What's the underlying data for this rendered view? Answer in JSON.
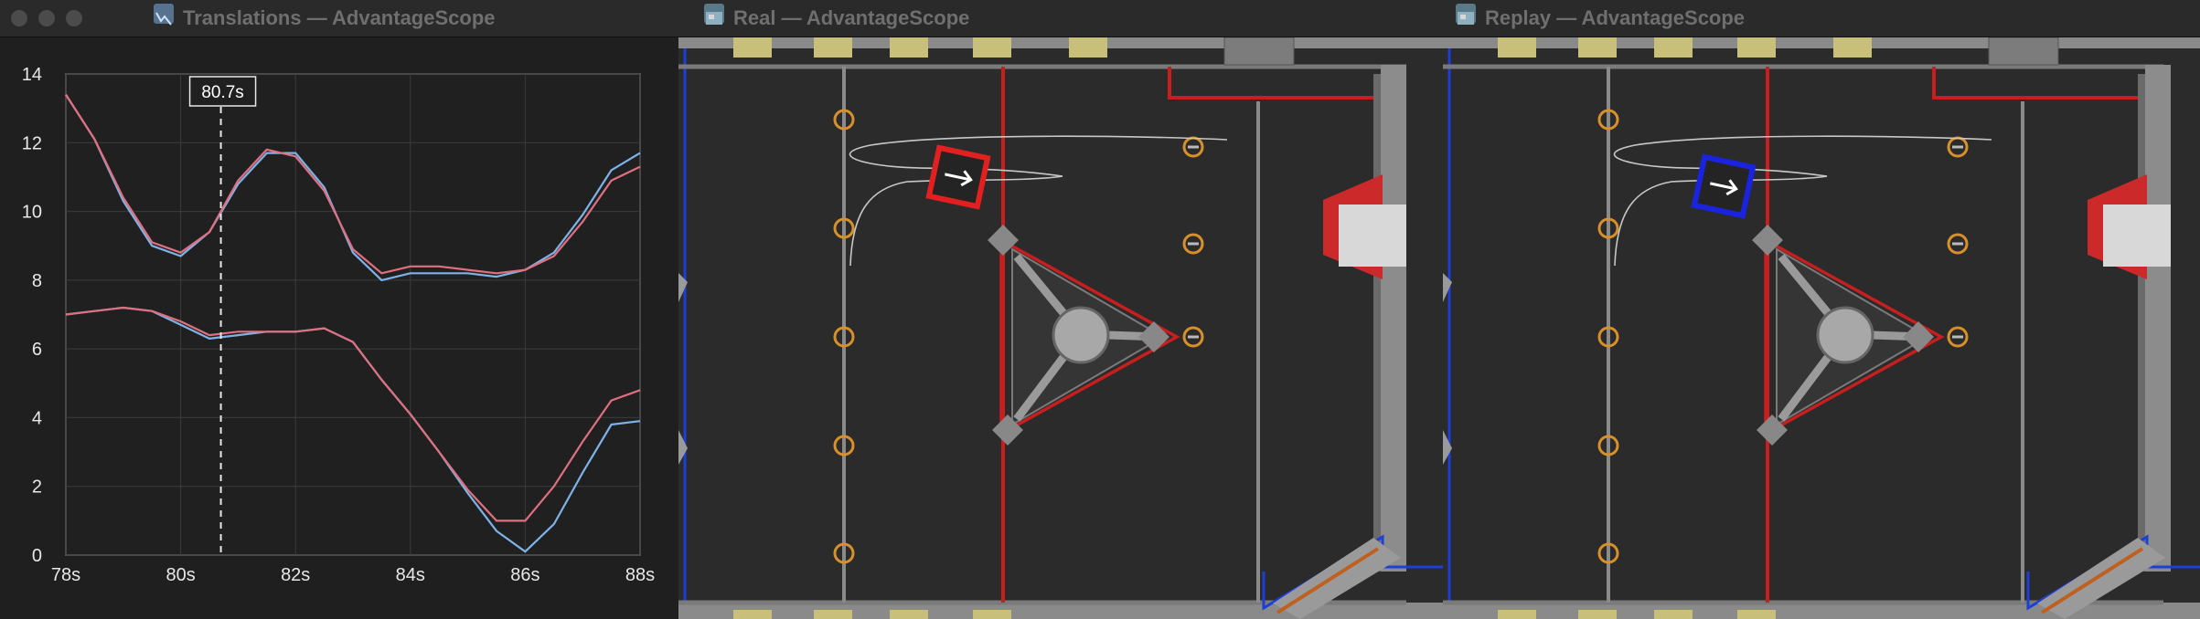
{
  "windows": {
    "translations": {
      "title": "Translations — AdvantageScope",
      "icon": "line-graph-icon"
    },
    "real": {
      "title": "Real — AdvantageScope",
      "icon": "field-map-icon"
    },
    "replay": {
      "title": "Replay — AdvantageScope",
      "icon": "field-map-icon"
    }
  },
  "chart_data": {
    "type": "line",
    "title": "",
    "xlabel": "",
    "ylabel": "",
    "xlim": [
      78,
      88
    ],
    "ylim": [
      0,
      14
    ],
    "x_ticks": [
      "78s",
      "80s",
      "82s",
      "84s",
      "86s",
      "88s"
    ],
    "y_ticks": [
      "0",
      "2",
      "4",
      "6",
      "8",
      "10",
      "12",
      "14"
    ],
    "grid": true,
    "cursor": {
      "x": 80.7,
      "label": "80.7s"
    },
    "x": [
      78,
      78.5,
      79,
      79.5,
      80,
      80.5,
      81,
      81.5,
      82,
      82.5,
      83,
      83.5,
      84,
      84.5,
      85,
      85.5,
      86,
      86.5,
      87,
      87.5,
      88
    ],
    "series": [
      {
        "color": "#7db3e8",
        "values": [
          13.4,
          12.1,
          10.3,
          9.0,
          8.7,
          9.4,
          10.8,
          11.7,
          11.7,
          10.7,
          8.8,
          8.0,
          8.2,
          8.2,
          8.2,
          8.1,
          8.3,
          8.8,
          9.9,
          11.2,
          11.7
        ]
      },
      {
        "color": "#e07080",
        "values": [
          13.4,
          12.1,
          10.4,
          9.1,
          8.8,
          9.4,
          10.9,
          11.8,
          11.6,
          10.6,
          8.9,
          8.2,
          8.4,
          8.4,
          8.3,
          8.2,
          8.3,
          8.7,
          9.7,
          10.9,
          11.3
        ]
      },
      {
        "color": "#7db3e8",
        "values": [
          7.0,
          7.1,
          7.2,
          7.1,
          6.7,
          6.3,
          6.4,
          6.5,
          6.5,
          6.6,
          6.2,
          5.1,
          4.1,
          3.0,
          1.8,
          0.7,
          0.1,
          0.9,
          2.4,
          3.8,
          3.9
        ]
      },
      {
        "color": "#e07080",
        "values": [
          7.0,
          7.1,
          7.2,
          7.1,
          6.8,
          6.4,
          6.5,
          6.5,
          6.5,
          6.6,
          6.2,
          5.1,
          4.1,
          3.0,
          1.9,
          1.0,
          1.0,
          2.0,
          3.3,
          4.5,
          4.8
        ]
      }
    ]
  }
}
